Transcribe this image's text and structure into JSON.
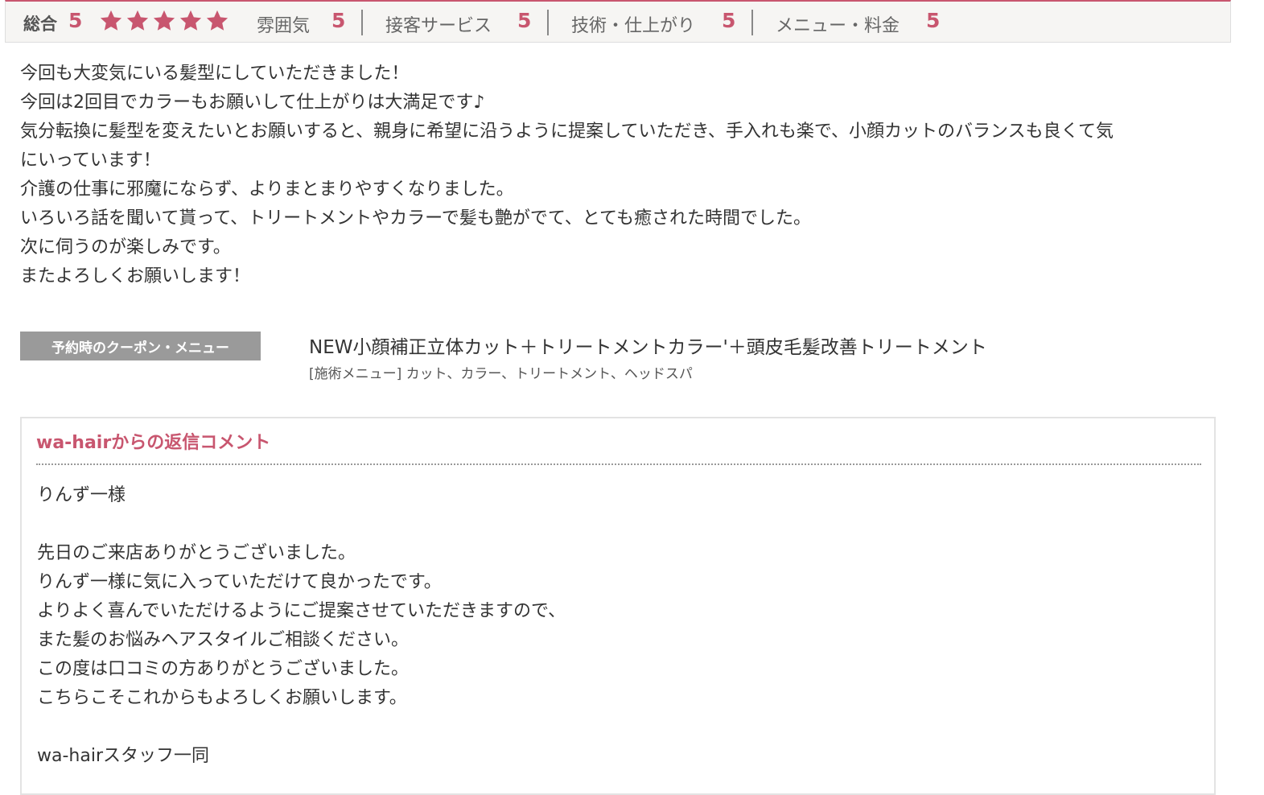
{
  "rating": {
    "overall_label": "総合",
    "overall_score": "5",
    "star_count": 5,
    "star_color": "#c8566f",
    "categories": [
      {
        "label": "雰囲気",
        "score": "5"
      },
      {
        "label": "接客サービス",
        "score": "5"
      },
      {
        "label": "技術・仕上がり",
        "score": "5"
      },
      {
        "label": "メニュー・料金",
        "score": "5"
      }
    ]
  },
  "review": {
    "lines": [
      "今回も大変気にいる髪型にしていただきました！",
      "今回は2回目でカラーもお願いして仕上がりは大満足です♪",
      "気分転換に髪型を変えたいとお願いすると、親身に希望に沿うように提案していただき、手入れも楽で、小顔カットのバランスも良くて気",
      "にいっています！",
      "介護の仕事に邪魔にならず、よりまとまりやすくなりました。",
      "いろいろ話を聞いて貰って、トリートメントやカラーで髪も艶がでて、とても癒された時間でした。",
      "次に伺うのが楽しみです。",
      "またよろしくお願いします！"
    ]
  },
  "coupon": {
    "badge": "予約時のクーポン・メニュー",
    "name": "NEW小顔補正立体カット＋トリートメントカラー'＋頭皮毛髪改善トリートメント",
    "menu": "[施術メニュー] カット、カラー、トリートメント、ヘッドスパ"
  },
  "reply": {
    "title": "wa-hairからの返信コメント",
    "lines": [
      "りんず一様",
      "",
      "先日のご来店ありがとうございました。",
      "りんず一様に気に入っていただけて良かったです。",
      "よりよく喜んでいただけるようにご提案させていただきますので、",
      "また髪のお悩みヘアスタイルご相談ください。",
      "この度は口コミの方ありがとうございました。",
      "こちらこそこれからもよろしくお願いします。",
      "",
      "wa-hairスタッフ一同"
    ]
  },
  "colors": {
    "accent": "#c8566f",
    "badge_bg": "#9a9a9a",
    "rating_bar_bg": "#f6f5f3"
  }
}
